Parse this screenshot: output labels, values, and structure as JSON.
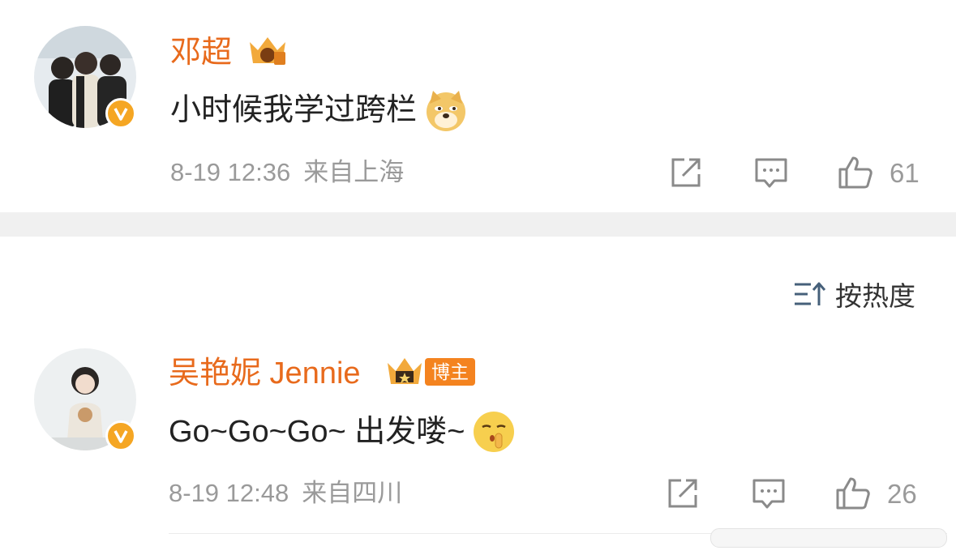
{
  "comments": [
    {
      "name": "邓超",
      "text": "小时候我学过跨栏",
      "emoji": "doge-emoji",
      "date": "8-19 12:36",
      "location": "来自上海",
      "likes": "61"
    },
    {
      "name": "吴艳妮 Jennie",
      "badge": "博主",
      "text": "Go~Go~Go~ 出发喽~",
      "emoji": "shush-emoji",
      "date": "8-19 12:48",
      "location": "来自四川",
      "likes": "26"
    }
  ],
  "sort": {
    "label": "按热度"
  },
  "icons": [
    "share-icon",
    "comment-icon",
    "like-icon",
    "sort-icon",
    "verified-icon",
    "crown-icon"
  ],
  "colors": {
    "name": "#e86a1c",
    "verified": "#f5a623",
    "meta": "#9a9a9a",
    "divider": "#f0f0f0"
  }
}
